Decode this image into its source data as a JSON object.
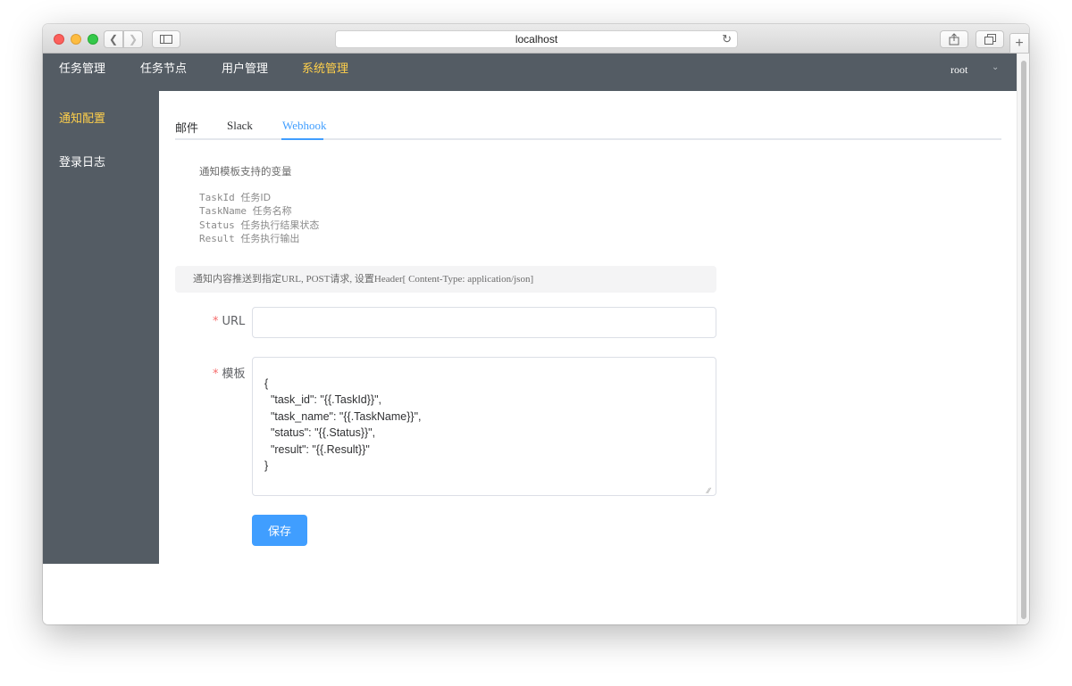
{
  "browser": {
    "address": "localhost",
    "icons": {
      "back": "chevron-left-icon",
      "forward": "chevron-right-icon",
      "sidebar": "sidebar-icon",
      "reload": "reload-icon",
      "share": "share-icon",
      "tabs": "tabs-icon",
      "new_tab": "plus-icon"
    }
  },
  "topnav": {
    "items": [
      {
        "label": "任务管理"
      },
      {
        "label": "任务节点"
      },
      {
        "label": "用户管理"
      },
      {
        "label": "系统管理",
        "active": true
      }
    ],
    "user": "root"
  },
  "sidemenu": {
    "items": [
      {
        "label": "通知配置",
        "active": true
      },
      {
        "label": "登录日志"
      }
    ]
  },
  "tabs": [
    {
      "label": "邮件"
    },
    {
      "label": "Slack"
    },
    {
      "label": "Webhook",
      "active": true
    }
  ],
  "help": {
    "title": "通知模板支持的变量",
    "variables": [
      {
        "name": "TaskId",
        "desc": "任务ID"
      },
      {
        "name": "TaskName",
        "desc": "任务名称"
      },
      {
        "name": "Status",
        "desc": "任务执行结果状态"
      },
      {
        "name": "Result",
        "desc": "任务执行输出"
      }
    ]
  },
  "info": "通知内容推送到指定URL, POST请求, 设置Header[ Content-Type: application/json]",
  "form": {
    "url_label": "URL",
    "url_value": "",
    "template_label": "模板",
    "template_value": "{\n  \"task_id\": \"{{.TaskId}}\",\n  \"task_name\": \"{{.TaskName}}\",\n  \"status\": \"{{.Status}}\",\n  \"result\": \"{{.Result}}\"\n}",
    "required_mark": "*",
    "save_label": "保存"
  },
  "colors": {
    "nav_bg": "#545c64",
    "active_text": "#ffd04b",
    "primary": "#409eff",
    "required": "#f56c6c"
  }
}
